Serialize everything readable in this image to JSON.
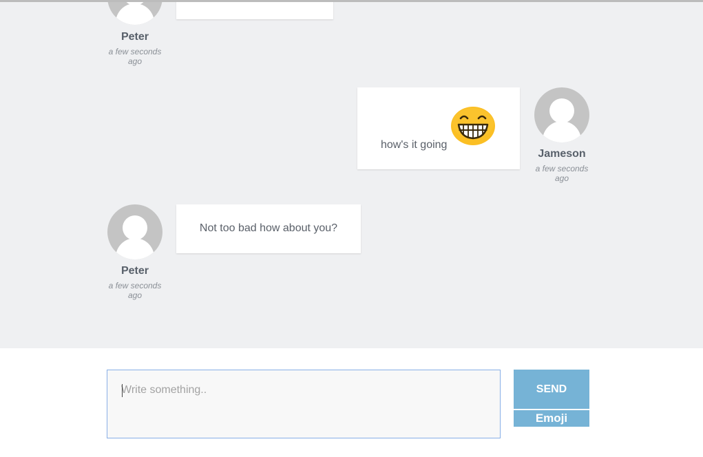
{
  "messages": [
    {
      "author": "Peter",
      "time": "a few seconds ago",
      "text": "",
      "side": "left"
    },
    {
      "author": "Jameson",
      "time": "a few seconds ago",
      "text": "how's it going",
      "side": "right",
      "emoji": "grinning-face-icon"
    },
    {
      "author": "Peter",
      "time": "a few seconds ago",
      "text": "Not too bad how about you?",
      "side": "left"
    }
  ],
  "composer": {
    "placeholder": "Write something..",
    "send_label": "SEND",
    "emoji_label": "Emoji"
  },
  "colors": {
    "chat_background": "#eff0f2",
    "avatar": "#c4c4c4",
    "button": "#76b3d6",
    "input_border": "#87aee6",
    "emoji_face": "#fbbf24"
  }
}
